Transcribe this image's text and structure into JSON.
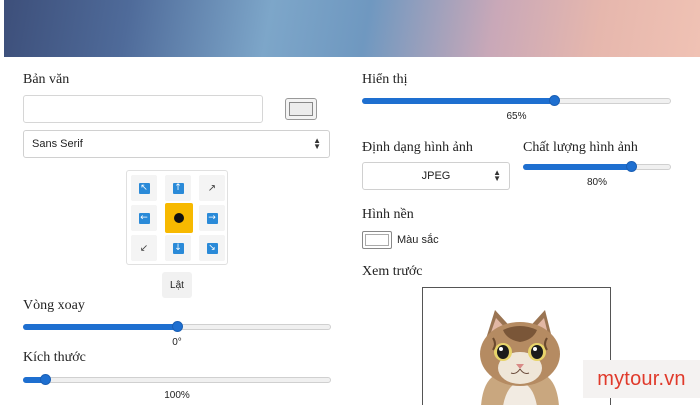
{
  "text_section": {
    "label": "Bản văn",
    "text_value": "",
    "font_select": "Sans Serif"
  },
  "position_grid": {
    "cells": [
      {
        "icon": "arrow-up-left-icon",
        "glyph": "↖"
      },
      {
        "icon": "arrow-up-icon",
        "glyph": "↑"
      },
      {
        "icon": "diagonal-up-right-icon",
        "glyph": "↗"
      },
      {
        "icon": "arrow-left-icon",
        "glyph": "←"
      },
      {
        "icon": "center-dot-icon",
        "glyph": ""
      },
      {
        "icon": "arrow-right-icon",
        "glyph": "→"
      },
      {
        "icon": "diagonal-down-left-icon",
        "glyph": "↙"
      },
      {
        "icon": "arrow-down-icon",
        "glyph": "↓"
      },
      {
        "icon": "arrow-down-right-icon",
        "glyph": "↘"
      }
    ],
    "selected": "center"
  },
  "flip_button": "Lật",
  "rotation": {
    "label": "Vòng xoay",
    "value_text": "0°",
    "fraction": 0.5
  },
  "size": {
    "label": "Kích thước",
    "value_text": "100%",
    "fraction": 0.07
  },
  "display": {
    "label": "Hiển thị",
    "value_text": "65%",
    "fraction": 0.62
  },
  "image_format": {
    "label": "Định dạng hình ảnh",
    "selected": "JPEG"
  },
  "image_quality": {
    "label": "Chất lượng hình ảnh",
    "value_text": "80%",
    "fraction": 0.73
  },
  "background": {
    "label": "Hình nền",
    "color_label": "Màu sắc"
  },
  "preview": {
    "label": "Xem trước"
  },
  "watermark": "mytour.vn",
  "colors": {
    "accent": "#1e6fd0",
    "active_cell": "#f7b900",
    "watermark": "#e03a2b"
  }
}
